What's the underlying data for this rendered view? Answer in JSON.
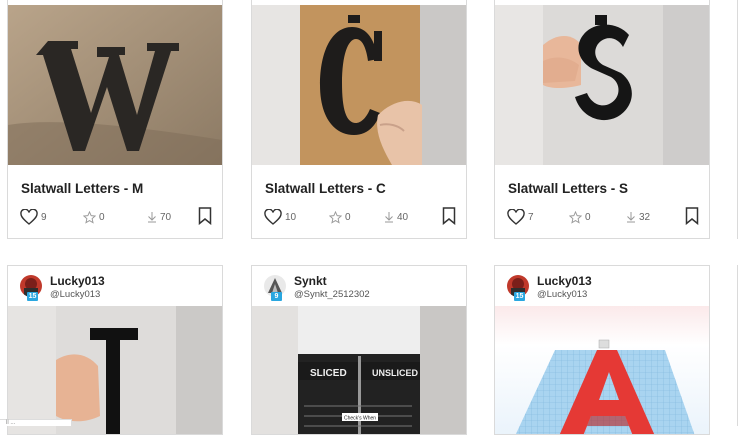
{
  "projects": [
    {
      "title": "Slatwall Letters - M",
      "likes": "9",
      "favorites": "0",
      "downloads": "70"
    },
    {
      "title": "Slatwall Letters - C",
      "likes": "10",
      "favorites": "0",
      "downloads": "40"
    },
    {
      "title": "Slatwall Letters - S",
      "likes": "7",
      "favorites": "0",
      "downloads": "32"
    }
  ],
  "posts": [
    {
      "name": "Lucky013",
      "handle": "@Lucky013",
      "level": "15"
    },
    {
      "name": "Synkt",
      "handle": "@Synkt_2512302",
      "level": "9"
    },
    {
      "name": "Lucky013",
      "handle": "@Lucky013",
      "level": "15"
    }
  ],
  "photo_text": {
    "sliced": "SLICED",
    "unsliced": "UNSLICED",
    "label_a": "Check's When"
  },
  "corner_text": "ll ..."
}
